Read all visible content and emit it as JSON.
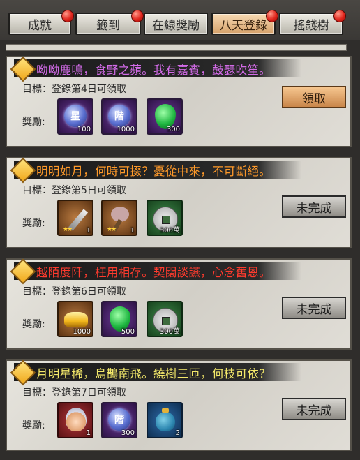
{
  "tabs": [
    {
      "label": "成就",
      "active": false,
      "has_notification": true
    },
    {
      "label": "籤到",
      "active": false,
      "has_notification": true
    },
    {
      "label": "在線獎勵",
      "active": false,
      "has_notification": false
    },
    {
      "label": "八天登錄",
      "active": true,
      "has_notification": true
    },
    {
      "label": "搖錢樹",
      "active": false,
      "has_notification": true
    }
  ],
  "common": {
    "reward_label": "獎勵:"
  },
  "cards": [
    {
      "title": "呦呦鹿鳴，食野之蘋。我有嘉賓，鼓瑟吹笙。",
      "title_color": "#d36be8",
      "goal": "目標：登錄第4日可領取",
      "button": "領取",
      "button_state": "claim",
      "rewards": [
        {
          "icon": "star-orb-icon",
          "glyph": "星",
          "qty": "100"
        },
        {
          "icon": "rank-orb-icon",
          "glyph": "階",
          "qty": "1000"
        },
        {
          "icon": "green-gem-icon",
          "qty": "300"
        }
      ]
    },
    {
      "title": "明明如月，何時可掇？憂從中來，不可斷絕。",
      "title_color": "#ff9a2a",
      "goal": "目標：登錄第5日可領取",
      "button": "未完成",
      "button_state": "incomplete",
      "rewards": [
        {
          "icon": "sword-icon",
          "qty": "1"
        },
        {
          "icon": "club-weapon-icon",
          "qty": "1"
        },
        {
          "icon": "silver-coin-icon",
          "qty": "300萬"
        }
      ]
    },
    {
      "title": "越陌度阡，枉用相存。契闊談讌，心念舊恩。",
      "title_color": "#ff3b2e",
      "goal": "目標：登錄第6日可領取",
      "button": "未完成",
      "button_state": "incomplete",
      "rewards": [
        {
          "icon": "gold-ingot-icon",
          "qty": "1000"
        },
        {
          "icon": "green-gem-icon",
          "qty": "500"
        },
        {
          "icon": "silver-coin-icon",
          "qty": "300萬"
        }
      ]
    },
    {
      "title": "月明星稀，烏鵲南飛。繞樹三匝，何枝可依？",
      "title_color": "#f3e86a",
      "goal": "目標：登錄第7日可領取",
      "button": "未完成",
      "button_state": "incomplete",
      "rewards": [
        {
          "icon": "hero-portrait-icon",
          "qty": "1"
        },
        {
          "icon": "rank-orb-icon",
          "glyph": "階",
          "qty": "300"
        },
        {
          "icon": "money-bag-icon",
          "qty": "2"
        }
      ]
    }
  ]
}
